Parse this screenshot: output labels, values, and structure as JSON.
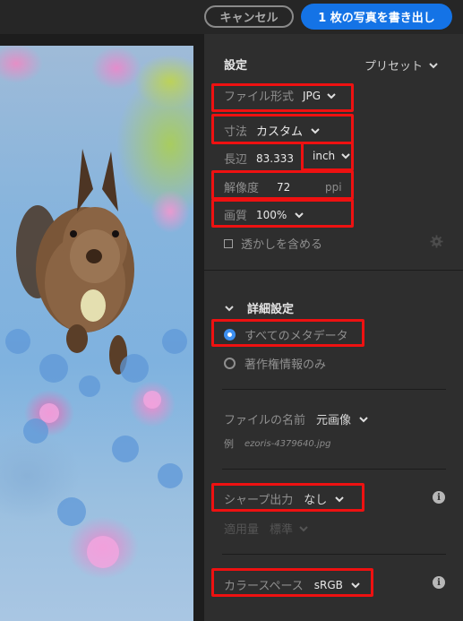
{
  "header": {
    "cancel_label": "キャンセル",
    "export_label": "1 枚の写真を書き出し",
    "export_color": "#1473e6"
  },
  "photo": {
    "subject": "squirrel among blue and pink flowers"
  },
  "settings": {
    "title": "設定",
    "preset_label": "プリセット",
    "file_format": {
      "label": "ファイル形式",
      "value": "JPG"
    },
    "dimensions": {
      "label": "寸法",
      "value": "カスタム"
    },
    "long_edge": {
      "label": "長辺",
      "value": "83.333",
      "unit": "inch"
    },
    "resolution": {
      "label": "解像度",
      "value": "72",
      "unit": "ppi"
    },
    "quality": {
      "label": "画質",
      "value": "100%"
    },
    "watermark": {
      "label": "透かしを含める",
      "checked": false
    }
  },
  "advanced": {
    "title": "詳細設定",
    "metadata_options": [
      {
        "label": "すべてのメタデータ",
        "selected": true
      },
      {
        "label": "著作権情報のみ",
        "selected": false
      }
    ],
    "file_name": {
      "label": "ファイルの名前",
      "value": "元画像"
    },
    "example": {
      "label": "例",
      "value": "ezoris-4379640.jpg"
    },
    "sharpen": {
      "label": "シャープ出力",
      "value": "なし"
    },
    "amount": {
      "label": "適用量",
      "value": "標準"
    },
    "color_space": {
      "label": "カラースペース",
      "value": "sRGB"
    }
  },
  "highlight_color": "#ee1111",
  "accent_color": "#3d8ff0"
}
